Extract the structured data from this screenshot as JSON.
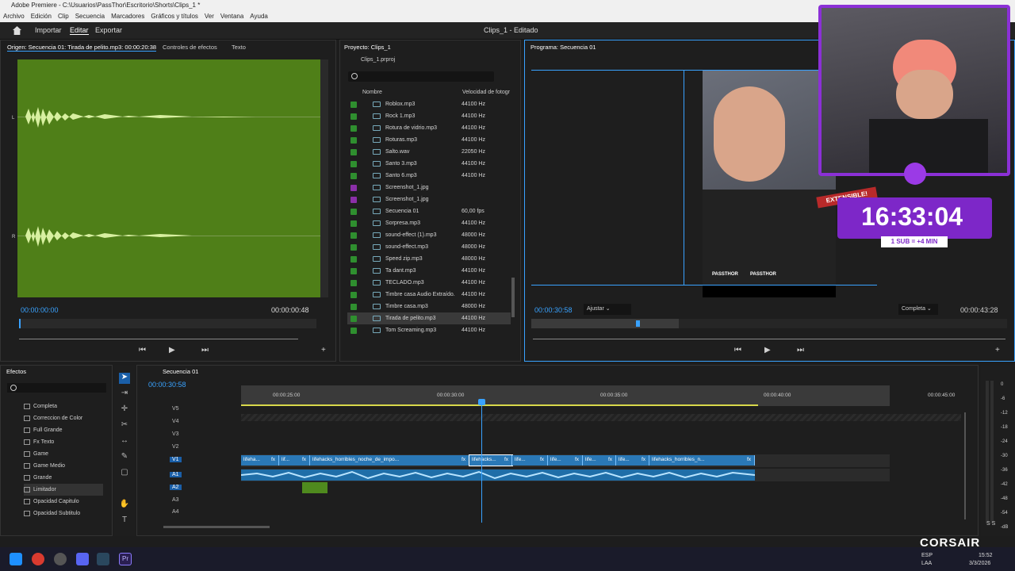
{
  "window": {
    "title": "Adobe Premiere - C:\\Usuarios\\PassThor\\Escritorio\\Shorts\\Clips_1 *"
  },
  "menu": [
    "Archivo",
    "Edición",
    "Clip",
    "Secuencia",
    "Marcadores",
    "Gráficos y títulos",
    "Ver",
    "Ventana",
    "Ayuda"
  ],
  "header": {
    "home": "home-icon",
    "tabs": [
      "Importar",
      "Editar",
      "Exportar"
    ],
    "project_title": "Clips_1 - Editado"
  },
  "source": {
    "tabs": [
      "Origen: Secuencia 01: Tirada de pelito.mp3: 00:00:20:38",
      "Controles de efectos",
      "Texto"
    ],
    "tc_in": "00:00:00:00",
    "tc_out": "00:00:00:48",
    "channel_l": "L",
    "channel_r": "R"
  },
  "project": {
    "title": "Proyecto: Clips_1",
    "file": "Clips_1.prproj",
    "col_name": "Nombre",
    "col_rate": "Velocidad de fotogr",
    "items": [
      {
        "name": "Roblox.mp3",
        "rate": "44100 Hz",
        "color": "#2f8f2f"
      },
      {
        "name": "Rock 1.mp3",
        "rate": "44100 Hz",
        "color": "#2f8f2f"
      },
      {
        "name": "Rotura de vidrio.mp3",
        "rate": "44100 Hz",
        "color": "#2f8f2f"
      },
      {
        "name": "Roturas.mp3",
        "rate": "44100 Hz",
        "color": "#2f8f2f"
      },
      {
        "name": "Salto.wav",
        "rate": "22050 Hz",
        "color": "#2f8f2f"
      },
      {
        "name": "Santo 3.mp3",
        "rate": "44100 Hz",
        "color": "#2f8f2f"
      },
      {
        "name": "Santo 6.mp3",
        "rate": "44100 Hz",
        "color": "#2f8f2f"
      },
      {
        "name": "Screenshot_1.jpg",
        "rate": "",
        "color": "#8b2fa8"
      },
      {
        "name": "Screenshot_1.jpg",
        "rate": "",
        "color": "#8b2fa8"
      },
      {
        "name": "Secuencia 01",
        "rate": "60,00 fps",
        "color": "#2f8f2f"
      },
      {
        "name": "Sorpresa.mp3",
        "rate": "44100 Hz",
        "color": "#2f8f2f"
      },
      {
        "name": "sound-effect (1).mp3",
        "rate": "48000 Hz",
        "color": "#2f8f2f"
      },
      {
        "name": "sound-effect.mp3",
        "rate": "48000 Hz",
        "color": "#2f8f2f"
      },
      {
        "name": "Speed zip.mp3",
        "rate": "48000 Hz",
        "color": "#2f8f2f"
      },
      {
        "name": "Ta dant.mp3",
        "rate": "44100 Hz",
        "color": "#2f8f2f"
      },
      {
        "name": "TECLADO.mp3",
        "rate": "44100 Hz",
        "color": "#2f8f2f"
      },
      {
        "name": "Timbre casa Audio Extraído.",
        "rate": "44100 Hz",
        "color": "#2f8f2f"
      },
      {
        "name": "Timbre casa.mp3",
        "rate": "48000 Hz",
        "color": "#2f8f2f"
      },
      {
        "name": "Tirada de pelito.mp3",
        "rate": "44100 Hz",
        "color": "#2f8f2f"
      },
      {
        "name": "Tom Screaming.mp3",
        "rate": "44100 Hz",
        "color": "#2f8f2f"
      }
    ]
  },
  "program": {
    "title": "Programa: Secuencia 01",
    "tc_in": "00:00:30:58",
    "fit": "Ajustar",
    "quality": "Completa",
    "tc_out": "00:00:43:28"
  },
  "overlay": {
    "badge": "EXTENSIBLE!",
    "timer": "16:33:04",
    "sub": "1 SUB = +4 MIN",
    "wm1": "PASSTHOR",
    "wm2": "PASSTHOR"
  },
  "effects": {
    "title": "Efectos",
    "items": [
      "Completa",
      "Correccion de Color",
      "Full Grande",
      "Fx Texto",
      "Game",
      "Game Medio",
      "Grande",
      "Limitador",
      "Opacidad Capitulo",
      "Opacidad Subtitulo"
    ]
  },
  "timeline": {
    "title": "Secuencia 01",
    "tc": "00:00:30:58",
    "ruler": [
      "00:00:25:00",
      "00:00:30:00",
      "00:00:35:00",
      "00:00:40:00",
      "00:00:45:00"
    ],
    "tracks_v": [
      "V5",
      "V4",
      "V3",
      "V2",
      "V1"
    ],
    "tracks_a": [
      "A1",
      "A2",
      "A3",
      "A4"
    ],
    "clips": [
      "lifeha...",
      "fx",
      "lif...",
      "fx",
      "lifehacks_horribles_noche_de_impo...",
      "fx",
      "lifehacks...",
      "fx",
      "life...",
      "fx",
      "life...",
      "fx",
      "life...",
      "fx",
      "life...",
      "fx",
      "lifehacks_horribles_n...",
      "fx"
    ],
    "meter": [
      "0",
      "-6",
      "-12",
      "-18",
      "-24",
      "-30",
      "-36",
      "-42",
      "-48",
      "-54",
      "-dB"
    ],
    "meter_footer": "S  S"
  },
  "taskbar": {
    "lang": "ESP",
    "lang2": "LAA",
    "time": "15:52",
    "date": "3/3/2026",
    "brand": "CORSAIR"
  }
}
